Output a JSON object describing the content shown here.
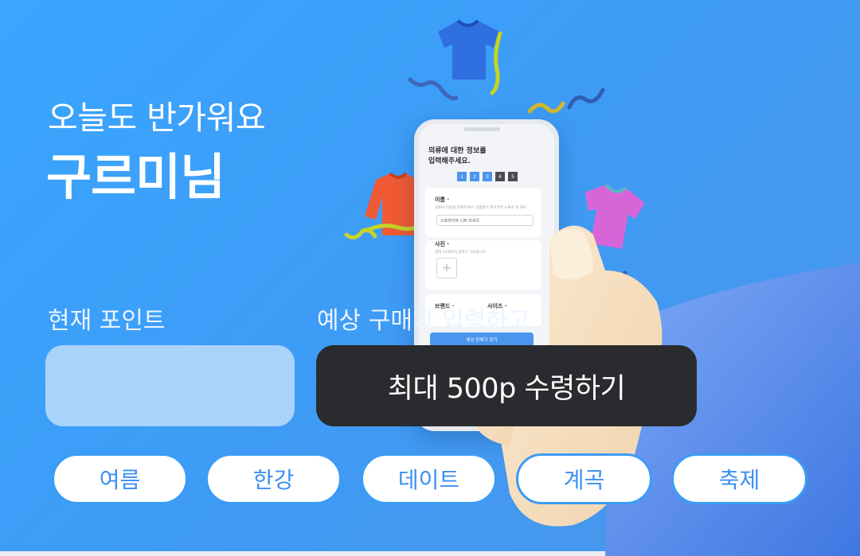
{
  "greeting": "오늘도 반가워요",
  "username": "구르미님",
  "points": {
    "label": "현재 포인트",
    "value": ""
  },
  "predict": {
    "label": "예상 구매가 입력하고",
    "cta": "최대 500p 수령하기"
  },
  "chips": [
    "여름",
    "한강",
    "데이트",
    "계곡",
    "축제"
  ],
  "phone_mockup": {
    "title_line1": "의류에 대한 정보를",
    "title_line2": "입력해주세요.",
    "steps": [
      "1",
      "2",
      "3",
      "4",
      "5"
    ],
    "name_label": "이름 ·",
    "name_hint": "의류의 이름을 정해주세요. 상품명이 들어가면 노출이 잘 돼요",
    "name_value": "스트라이프 니트 티셔츠",
    "photo_label": "사진 ·",
    "photo_hint": "최대 10개까지 업로드 가능합니다.",
    "photo_add": "+",
    "brand_label": "브랜드 ·",
    "size_label": "사이즈 ·",
    "button": "예상 판매가 정기"
  },
  "colors": {
    "background_start": "#3aa6ff",
    "background_end": "#4b94ea",
    "cta_bg": "#2a2b2e",
    "chip_border": "#3b9cf5",
    "chip_text": "#3b8ff0",
    "points_box": "#a9d3fb"
  },
  "icons": [
    "blue-tshirt-icon",
    "red-sweater-icon",
    "pink-tshirt-icon",
    "confetti-ribbon-icon"
  ]
}
